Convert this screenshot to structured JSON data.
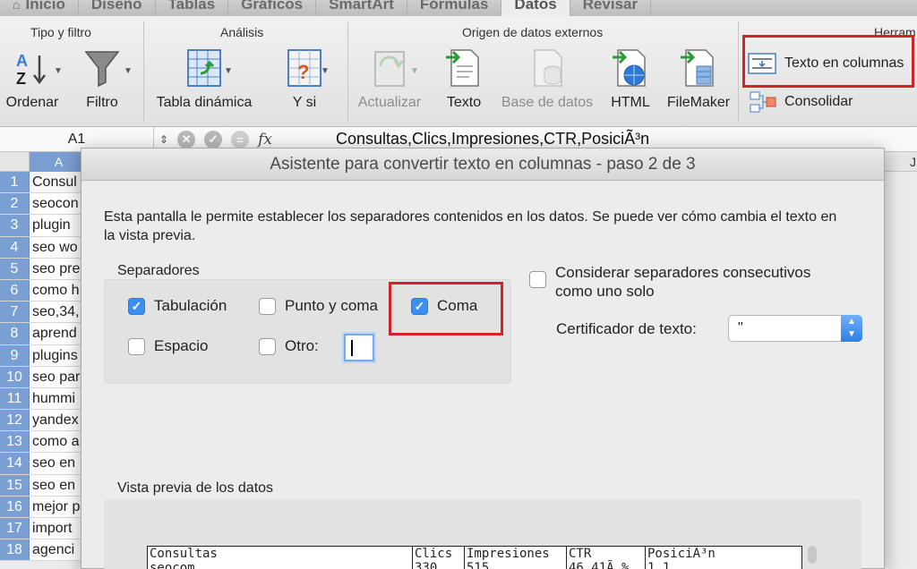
{
  "tabs": [
    {
      "label": "Inicio",
      "active": false
    },
    {
      "label": "Diseño",
      "active": false
    },
    {
      "label": "Tablas",
      "active": false
    },
    {
      "label": "Gráficos",
      "active": false
    },
    {
      "label": "SmartArt",
      "active": false
    },
    {
      "label": "Fórmulas",
      "active": false
    },
    {
      "label": "Datos",
      "active": true
    },
    {
      "label": "Revisar",
      "active": false
    }
  ],
  "ribbon": {
    "groups": {
      "sort_filter": "Tipo y filtro",
      "analysis": "Análisis",
      "external": "Origen de datos externos",
      "tools": "Herram"
    },
    "buttons": {
      "ordenar": "Ordenar",
      "filtro": "Filtro",
      "tabla_dinamica": "Tabla dinámica",
      "y_si": "Y si",
      "actualizar": "Actualizar",
      "texto": "Texto",
      "base_de_datos": "Base de datos",
      "html": "HTML",
      "filemaker": "FileMaker",
      "texto_en_columnas": "Texto en columnas",
      "consolidar": "Consolidar"
    }
  },
  "formula_bar": {
    "name_box": "A1",
    "fx": "fx",
    "content": "Consultas,Clics,Impresiones,CTR,PosiciÃ³n"
  },
  "sheet": {
    "col_a": "A",
    "col_j": "J",
    "rows": [
      {
        "n": "1",
        "v": "Consul"
      },
      {
        "n": "2",
        "v": "seocon"
      },
      {
        "n": "3",
        "v": "plugin"
      },
      {
        "n": "4",
        "v": "seo wo"
      },
      {
        "n": "5",
        "v": "seo pre"
      },
      {
        "n": "6",
        "v": "como h"
      },
      {
        "n": "7",
        "v": "seo,34,"
      },
      {
        "n": "8",
        "v": "aprend"
      },
      {
        "n": "9",
        "v": "plugins"
      },
      {
        "n": "10",
        "v": "seo par"
      },
      {
        "n": "11",
        "v": "hummi"
      },
      {
        "n": "12",
        "v": "yandex"
      },
      {
        "n": "13",
        "v": "como a"
      },
      {
        "n": "14",
        "v": "seo en"
      },
      {
        "n": "15",
        "v": "seo en"
      },
      {
        "n": "16",
        "v": "mejor p"
      },
      {
        "n": "17",
        "v": "import"
      },
      {
        "n": "18",
        "v": "agenci"
      }
    ]
  },
  "dialog": {
    "title": "Asistente para convertir texto en columnas - paso 2 de 3",
    "description": "Esta pantalla le permite establecer los separadores contenidos en los datos. Se puede ver cómo cambia el texto en la vista previa.",
    "separators_label": "Separadores",
    "options": {
      "tabulacion": {
        "label": "Tabulación",
        "checked": true
      },
      "punto_y_coma": {
        "label": "Punto y coma",
        "checked": false
      },
      "coma": {
        "label": "Coma",
        "checked": true
      },
      "espacio": {
        "label": "Espacio",
        "checked": false
      },
      "otro": {
        "label": "Otro:",
        "checked": false
      }
    },
    "otro_value": "",
    "consecutive_label": "Considerar separadores consecutivos como uno solo",
    "consecutive_checked": false,
    "qualifier_label": "Certificador de texto:",
    "qualifier_value": "\"",
    "preview_label": "Vista previa de los datos",
    "preview": {
      "headers": [
        "Consultas",
        "Clics",
        "Impresiones",
        "CTR",
        "PosiciÃ³n"
      ],
      "row2": [
        "seocom",
        "330",
        "515",
        "46,41Ã %",
        "1,1"
      ]
    }
  },
  "colors": {
    "highlight": "#d2232a",
    "selection": "#7a9fd2",
    "checkbox_on": "#3b8ef2"
  }
}
